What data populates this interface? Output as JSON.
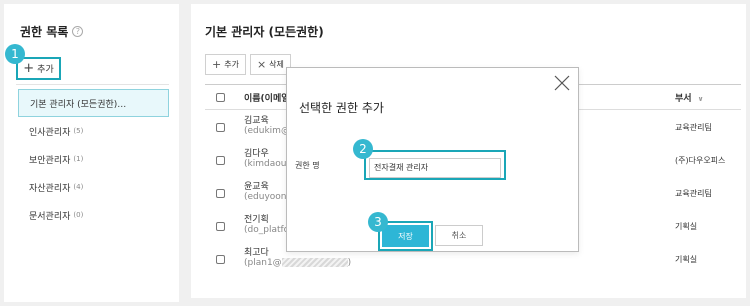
{
  "sidebar": {
    "title": "권한 목록",
    "help_icon": "?",
    "add_button": {
      "icon": "+",
      "label": "추가"
    },
    "items": [
      {
        "label": "기본 관리자 (모든권한)…",
        "count": ""
      },
      {
        "label": "인사관리자",
        "count": "(5)"
      },
      {
        "label": "보안관리자",
        "count": "(1)"
      },
      {
        "label": "자산관리자",
        "count": "(4)"
      },
      {
        "label": "문서관리자",
        "count": "(0)"
      }
    ]
  },
  "main": {
    "title": "기본 관리자 (모든권한)",
    "toolbar": {
      "add": {
        "icon": "+",
        "label": "추가"
      },
      "delete": {
        "icon": "×",
        "label": "삭제"
      }
    },
    "table": {
      "col_name": "이름(이메일",
      "col_dept": "부서",
      "col_dept_icon": "chevron-down-icon",
      "rows": [
        {
          "name": "김교육",
          "email": "(edukim@",
          "dept": "교육관리팀"
        },
        {
          "name": "김다우",
          "email": "(kimdaou@",
          "dept": "(주)다우오피스"
        },
        {
          "name": "윤교육",
          "email": "(eduyoon@",
          "dept": "교육관리팀"
        },
        {
          "name": "전기획",
          "email": "(do_platfo",
          "dept": "기획실"
        },
        {
          "name": "최고다",
          "email": "(plan1@",
          "email_suffix": ")",
          "dept": "기획실"
        }
      ]
    }
  },
  "modal": {
    "title": "선택한 권한 추가",
    "label": "권한 명",
    "input_value": "전자결재 관리자",
    "save_label": "저장",
    "cancel_label": "취소"
  },
  "steps": {
    "one": "1",
    "two": "2",
    "three": "3"
  },
  "colors": {
    "accent": "#1aa6b7",
    "badge": "#35b8d0",
    "save": "#2db6d6",
    "active_bg": "#e8f8fb"
  }
}
